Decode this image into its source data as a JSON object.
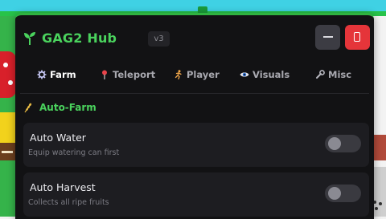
{
  "window": {
    "title": "GAG2 Hub",
    "version": "v3",
    "accent_color": "#4ad25d"
  },
  "tabs": [
    {
      "label": "Farm",
      "icon": "gear-icon",
      "active": true
    },
    {
      "label": "Teleport",
      "icon": "pin-icon",
      "active": false
    },
    {
      "label": "Player",
      "icon": "running-person-icon",
      "active": false
    },
    {
      "label": "Visuals",
      "icon": "eye-icon",
      "active": false
    },
    {
      "label": "Misc",
      "icon": "wrench-icon",
      "active": false
    }
  ],
  "section": {
    "title": "Auto-Farm",
    "icon": "wheat-icon"
  },
  "options": [
    {
      "label": "Auto Water",
      "description": "Equip watering can first",
      "enabled": false
    },
    {
      "label": "Auto Harvest",
      "description": "Collects all ripe fruits",
      "enabled": false
    }
  ]
}
